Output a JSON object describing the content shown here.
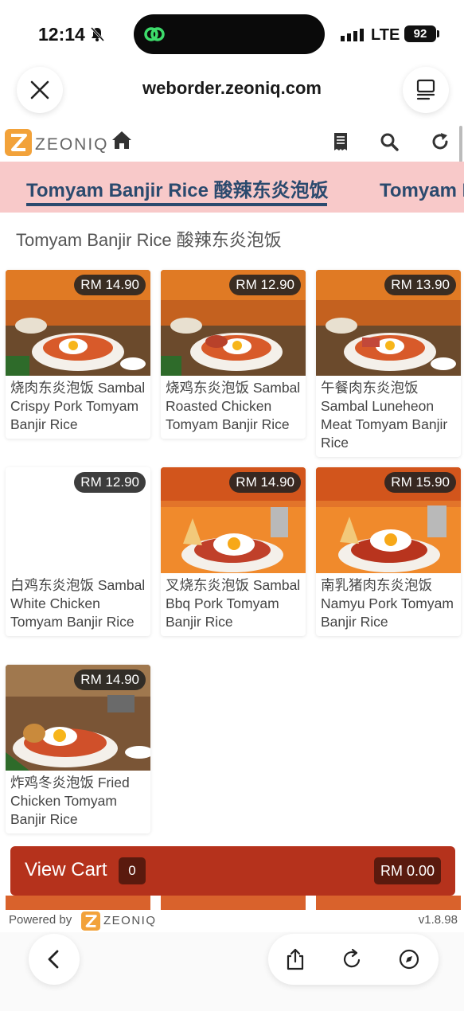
{
  "status_bar": {
    "time": "12:14",
    "network": "LTE",
    "battery": "92"
  },
  "browser": {
    "url": "weborder.zeoniq.com"
  },
  "site": {
    "brand": "ZEONIQ"
  },
  "categories": [
    {
      "label": "Tomyam Banjir Rice 酸辣东炎泡饭",
      "active": true
    },
    {
      "label": "Tomyam Banjir Rice 酸辣东炎泡饭",
      "active": false
    }
  ],
  "section_title": "Tomyam Banjir Rice 酸辣东炎泡饭",
  "products": [
    {
      "price": "RM 14.90",
      "name": "烧肉东炎泡饭 Sambal Crispy Pork Tomyam Banjir Rice",
      "image": "photo"
    },
    {
      "price": "RM 12.90",
      "name": "烧鸡东炎泡饭 Sambal Roasted Chicken Tomyam Banjir Rice",
      "image": "photo"
    },
    {
      "price": "RM 13.90",
      "name": "午餐肉东炎泡饭 Sambal Luneheon Meat Tomyam Banjir Rice",
      "image": "photo"
    },
    {
      "price": "RM 12.90",
      "name": "白鸡东炎泡饭 Sambal White Chicken Tomyam Banjir Rice",
      "image": "none"
    },
    {
      "price": "RM 14.90",
      "name": "叉烧东炎泡饭 Sambal Bbq Pork Tomyam Banjir Rice",
      "image": "photo"
    },
    {
      "price": "RM 15.90",
      "name": "南乳猪肉东炎泡饭 Namyu Pork Tomyam Banjir Rice",
      "image": "photo"
    },
    {
      "price": "RM 14.90",
      "name": "炸鸡冬炎泡饭 Fried Chicken Tomyam Banjir Rice",
      "image": "photo"
    }
  ],
  "cart": {
    "label": "View Cart",
    "count": "0",
    "total": "RM 0.00"
  },
  "footer": {
    "powered_by": "Powered by",
    "brand": "ZEONIQ",
    "version": "v1.8.98"
  },
  "colors": {
    "accent": "#b5321c",
    "tab_bg": "#f8c9c9",
    "tab_text": "#2b4a6e",
    "logo_orange": "#f2a23a"
  }
}
